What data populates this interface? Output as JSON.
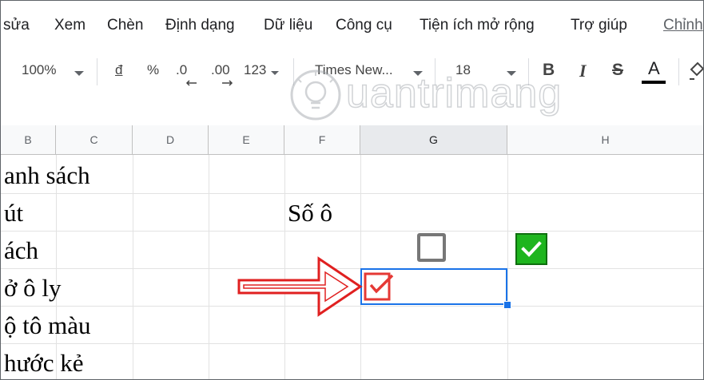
{
  "menu": {
    "items": [
      "sửa",
      "Xem",
      "Chèn",
      "Định dạng",
      "Dữ liệu",
      "Công cụ",
      "Tiện ích mở rộng",
      "Trợ giúp"
    ],
    "edit_link": "Chỉnh"
  },
  "toolbar": {
    "zoom": "100%",
    "currency": "đ",
    "percent": "%",
    "decrease_decimal": ".0",
    "increase_decimal": ".00",
    "number_format": "123",
    "font": "Times New...",
    "font_size": "18",
    "bold": "B",
    "italic": "I",
    "strikethrough": "S",
    "text_color": "A",
    "text_color_value": "#000000"
  },
  "columns": [
    "B",
    "C",
    "D",
    "E",
    "F",
    "G",
    "H"
  ],
  "selected_column": "G",
  "rows": [
    "anh sách",
    "út",
    "ách",
    "ở ô ly",
    "ộ tô màu",
    "hước kẻ"
  ],
  "cell_f2": "Số ô",
  "checkboxes": [
    {
      "cell": "G3",
      "checked": false,
      "style": "gray"
    },
    {
      "cell": "H3",
      "checked": true,
      "style": "green",
      "color": "#1eb51e"
    },
    {
      "cell": "F4",
      "checked": true,
      "style": "red",
      "color": "#e53935"
    }
  ],
  "selection": {
    "range": "F4:G4",
    "color": "#1a73e8"
  },
  "watermark": "uantrimang",
  "colors": {
    "accent": "#1a73e8",
    "arrow": "#e02020"
  }
}
